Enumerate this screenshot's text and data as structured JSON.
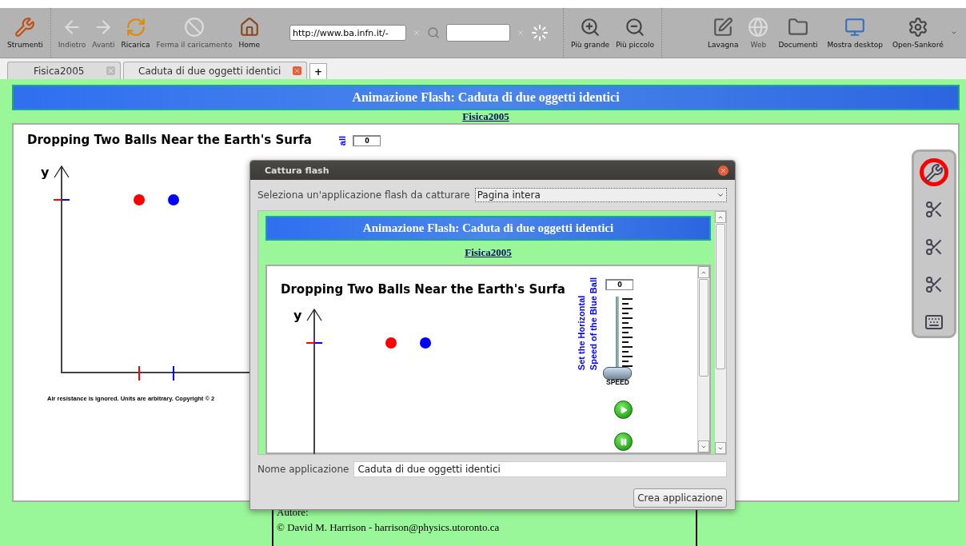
{
  "toolbar": {
    "left": [
      {
        "kind": "tools",
        "label": "Strumenti",
        "disabled": false
      },
      {
        "kind": "back",
        "label": "Indietro",
        "disabled": true
      },
      {
        "kind": "forward",
        "label": "Avanti",
        "disabled": true
      },
      {
        "kind": "reload",
        "label": "Ricarica",
        "disabled": false
      },
      {
        "kind": "stop",
        "label": "Ferma il caricamento",
        "disabled": true
      },
      {
        "kind": "home",
        "label": "Home",
        "disabled": false
      }
    ],
    "url": "http://www.ba.infn.it/-",
    "zoom": [
      {
        "kind": "zoom-in",
        "label": "Più grande",
        "disabled": false
      },
      {
        "kind": "zoom-out",
        "label": "Più piccolo",
        "disabled": false
      }
    ],
    "right": [
      {
        "kind": "board",
        "label": "Lavagna",
        "disabled": false
      },
      {
        "kind": "web",
        "label": "Web",
        "disabled": true
      },
      {
        "kind": "documents",
        "label": "Documenti",
        "disabled": false
      },
      {
        "kind": "desktop",
        "label": "Mostra desktop",
        "disabled": false
      },
      {
        "kind": "app",
        "label": "Open-Sankoré",
        "disabled": false
      }
    ]
  },
  "tabs": [
    {
      "label": "Fisica2005",
      "selected": false
    },
    {
      "label": "Caduta di due oggetti identici",
      "selected": true
    }
  ],
  "new_tab": "+",
  "page": {
    "banner": "Animazione Flash: Caduta di due oggetti identici",
    "link": "Fisica2005",
    "flash": {
      "title": "Dropping Two Balls Near the Earth's Surfa",
      "y_label": "y",
      "speed_value": "0",
      "vertical_label": "all",
      "caption": "Air resistance is ignored. Units are arbitrary. Copyright © 2"
    },
    "author": {
      "label": "Autore:",
      "text": "© David M. Harrison - harrison@physics.utoronto.ca"
    }
  },
  "dialog": {
    "title": "Cattura flash",
    "select_label": "Seleziona un'applicazione flash da catturare",
    "select_value": "Pagina intera",
    "preview": {
      "banner": "Animazione Flash: Caduta di due oggetti identici",
      "link": "Fisica2005",
      "flash": {
        "title": "Dropping Two Balls Near the Earth's Surfa",
        "y_label": "y",
        "speed_value": "0",
        "vertical_lines": [
          "Set the Horizontal",
          "Speed of the Blue Ball"
        ],
        "slider": {
          "label": "SPEED",
          "level": 0
        }
      }
    },
    "name_label": "Nome applicazione",
    "name_value": "Caduta di due oggetti identici",
    "button": "Crea applicazione"
  },
  "side_toolbar": [
    {
      "kind": "tools",
      "selected": true
    },
    {
      "kind": "capture-area",
      "selected": false
    },
    {
      "kind": "capture-page",
      "selected": false
    },
    {
      "kind": "capture-video",
      "selected": false
    },
    {
      "kind": "keyboard",
      "selected": false
    }
  ]
}
